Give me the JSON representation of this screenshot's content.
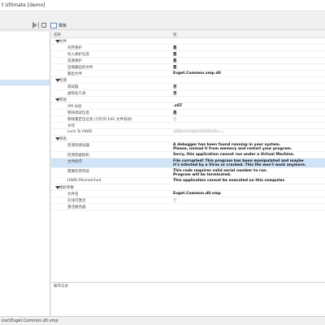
{
  "window": {
    "title": "t Ultimate [demo]"
  },
  "toolbar": {
    "run_label": "",
    "project_label": "模板"
  },
  "table": {
    "col_name": "名称",
    "col_value": "值",
    "rows": [
      {
        "type": "group",
        "label": "文件"
      },
      {
        "type": "item",
        "key": "内存保护",
        "value": "是"
      },
      {
        "type": "item",
        "key": "导入保护信息",
        "value": "是"
      },
      {
        "type": "item",
        "key": "资源保护",
        "value": "是"
      },
      {
        "type": "item",
        "key": "压缩输出的文件",
        "value": "是"
      },
      {
        "type": "item",
        "key": "输出文件",
        "value": "Evget.Common.vmp.dll"
      },
      {
        "type": "group",
        "label": "检测"
      },
      {
        "type": "item",
        "key": "调试器",
        "value": "否"
      },
      {
        "type": "item",
        "key": "虚拟化工具",
        "value": "否"
      },
      {
        "type": "group",
        "label": "其他"
      },
      {
        "type": "item",
        "key": "VM 分段",
        "value": ".xGT"
      },
      {
        "type": "item",
        "key": "移除调试信息",
        "value": "是"
      },
      {
        "type": "item",
        "key": "移除重定位信息 (只针对 EXE 文件有效)",
        "value": "否",
        "gray": true
      },
      {
        "type": "item",
        "key": "水印",
        "value": ""
      },
      {
        "type": "item",
        "key": "Lock To HWID",
        "value": "aDBULB3dUjV4S03RXZU==",
        "gray": true
      },
      {
        "type": "group",
        "label": "消息"
      },
      {
        "type": "item",
        "key": "检测到调试器",
        "value": "A debugger has been found running in your system.\nPlease, unload it from memory and restart your program."
      },
      {
        "type": "item",
        "key": "检测到虚拟机",
        "value": "Sorry, this application cannot run under a Virtual Machine."
      },
      {
        "type": "item",
        "key": "文件损坏",
        "value": "File corrupted! This program has been manipulated and maybe\nit's infected by a Virus or cracked. This file won't work anymore.",
        "selected": true
      },
      {
        "type": "item",
        "key": "需要的序列号",
        "value": "This code requires valid serial number to run.\nProgram will be terminated."
      },
      {
        "type": "item",
        "key": "HWID Mismatched",
        "value": "This application cannot be executed on this computer."
      },
      {
        "type": "group",
        "label": "授权参数"
      },
      {
        "type": "item",
        "key": "文件名",
        "value": "Evget.Common.dll.vmp"
      },
      {
        "type": "item",
        "key": "在线可激活",
        "value": "否",
        "gray": true
      },
      {
        "type": "item",
        "key": "激活服务器",
        "value": ""
      }
    ]
  },
  "bottom": {
    "caption": "编译记录"
  },
  "status": {
    "text": "lcer\\Evget.Common.dll.vmp"
  }
}
